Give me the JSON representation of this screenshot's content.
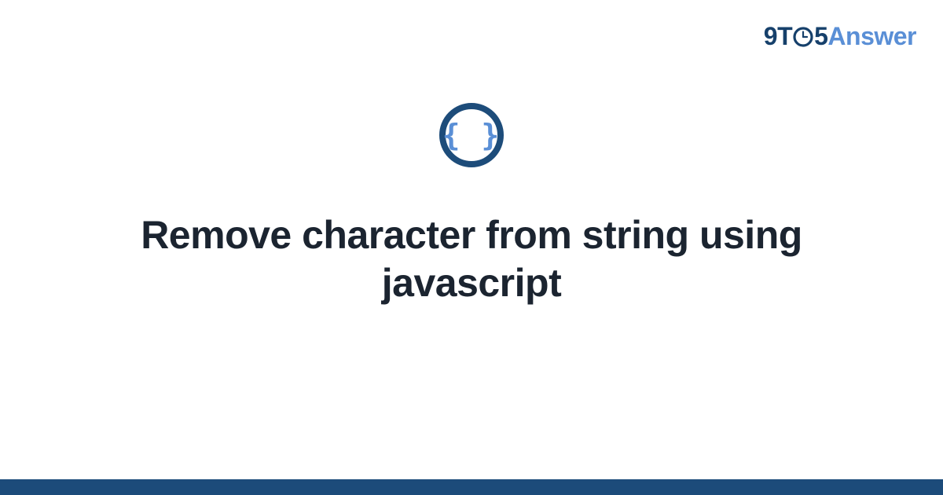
{
  "brand": {
    "part1": "9T",
    "part2": "5",
    "part3": "Answer"
  },
  "icon": {
    "name": "code-braces-icon"
  },
  "main": {
    "title": "Remove character from string using javascript"
  },
  "colors": {
    "brand_dark": "#16406b",
    "brand_light": "#5a8fd6",
    "title_color": "#1b2430",
    "bar_color": "#1c4b7a"
  }
}
